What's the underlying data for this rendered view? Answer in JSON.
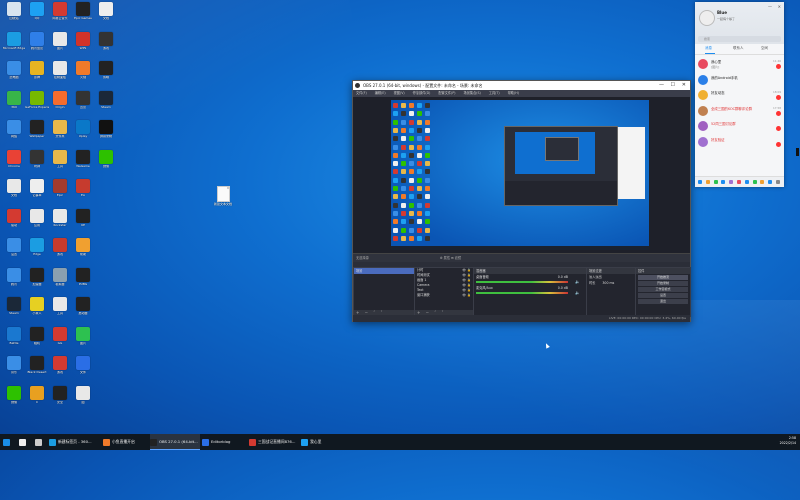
{
  "desktop": {
    "icons": [
      {
        "label": "回收站",
        "color": "#d8e4ef",
        "col": 0,
        "row": 0
      },
      {
        "label": "QQ",
        "color": "#1da1f2",
        "col": 1,
        "row": 0
      },
      {
        "label": "网易云音乐",
        "color": "#d33a31",
        "col": 2,
        "row": 0
      },
      {
        "label": "Epic Games",
        "color": "#222222",
        "col": 3,
        "row": 0
      },
      {
        "label": "文档",
        "color": "#eeeeee",
        "col": 4,
        "row": 0
      },
      {
        "label": "Microsoft Edge",
        "color": "#1b9de2",
        "col": 0,
        "row": 1
      },
      {
        "label": "腾讯会议",
        "color": "#2f7fe8",
        "col": 1,
        "row": 1
      },
      {
        "label": "图片",
        "color": "#e8e8e8",
        "col": 2,
        "row": 1
      },
      {
        "label": "WPS",
        "color": "#d2332a",
        "col": 3,
        "row": 1
      },
      {
        "label": "游戏",
        "color": "#333333",
        "col": 4,
        "row": 1
      },
      {
        "label": "此电脑",
        "color": "#3a8ee6",
        "col": 0,
        "row": 2
      },
      {
        "label": "原神",
        "color": "#e6b422",
        "col": 1,
        "row": 2
      },
      {
        "label": "控制面板",
        "color": "#e8e8e8",
        "col": 2,
        "row": 2
      },
      {
        "label": "火绒",
        "color": "#f07a2a",
        "col": 3,
        "row": 2
      },
      {
        "label": "剪映",
        "color": "#222222",
        "col": 4,
        "row": 2
      },
      {
        "label": "360",
        "color": "#38b549",
        "col": 0,
        "row": 3
      },
      {
        "label": "GeForce Experience",
        "color": "#76b900",
        "col": 1,
        "row": 3
      },
      {
        "label": "Origin",
        "color": "#f56c2d",
        "col": 2,
        "row": 3
      },
      {
        "label": "迅雷",
        "color": "#333333",
        "col": 3,
        "row": 3
      },
      {
        "label": "Steam",
        "color": "#1b2838",
        "col": 4,
        "row": 3
      },
      {
        "label": "网络",
        "color": "#3a8ee6",
        "col": 0,
        "row": 4
      },
      {
        "label": "Wallpaper",
        "color": "#222222",
        "col": 1,
        "row": 4
      },
      {
        "label": "文件夹",
        "color": "#e8b84a",
        "col": 2,
        "row": 4
      },
      {
        "label": "Uplay",
        "color": "#0a78c8",
        "col": 3,
        "row": 4
      },
      {
        "label": "屏幕录制",
        "color": "#111111",
        "col": 4,
        "row": 4
      },
      {
        "label": "Chrome",
        "color": "#e94235",
        "col": 0,
        "row": 5
      },
      {
        "label": "时钟",
        "color": "#333333",
        "col": 1,
        "row": 5
      },
      {
        "label": "工具",
        "color": "#e8b84a",
        "col": 2,
        "row": 5
      },
      {
        "label": "WeGame",
        "color": "#222222",
        "col": 3,
        "row": 5
      },
      {
        "label": "微信",
        "color": "#2dc100",
        "col": 4,
        "row": 5
      },
      {
        "label": "文档",
        "color": "#e8e8e8",
        "col": 0,
        "row": 6
      },
      {
        "label": "记事本",
        "color": "#eeeeee",
        "col": 1,
        "row": 6
      },
      {
        "label": "Epic",
        "color": "#a33b2e",
        "col": 2,
        "row": 6
      },
      {
        "label": "EA",
        "color": "#c63b2e",
        "col": 3,
        "row": 6
      },
      {
        "label": "驱动",
        "color": "#d33a31",
        "col": 0,
        "row": 7
      },
      {
        "label": "应用",
        "color": "#e8e8e8",
        "col": 1,
        "row": 7
      },
      {
        "label": "Rockstar",
        "color": "#e8e8e8",
        "col": 2,
        "row": 7
      },
      {
        "label": "UE",
        "color": "#222222",
        "col": 3,
        "row": 7
      },
      {
        "label": "设置",
        "color": "#3a8ee6",
        "col": 0,
        "row": 8
      },
      {
        "label": "Edge",
        "color": "#1b9de2",
        "col": 1,
        "row": 8
      },
      {
        "label": "游戏",
        "color": "#c63b2e",
        "col": 2,
        "row": 8
      },
      {
        "label": "帮助",
        "color": "#f0a030",
        "col": 3,
        "row": 8
      },
      {
        "label": "腾讯",
        "color": "#3a8ee6",
        "col": 0,
        "row": 9
      },
      {
        "label": "加速器",
        "color": "#222222",
        "col": 1,
        "row": 9
      },
      {
        "label": "模拟器",
        "color": "#8aa0b0",
        "col": 2,
        "row": 9
      },
      {
        "label": "PUBG",
        "color": "#222222",
        "col": 3,
        "row": 9
      },
      {
        "label": "Steam",
        "color": "#1b2838",
        "col": 0,
        "row": 10
      },
      {
        "label": "小黄人",
        "color": "#e6d022",
        "col": 1,
        "row": 10
      },
      {
        "label": "工具",
        "color": "#e8e8e8",
        "col": 2,
        "row": 10
      },
      {
        "label": "启动器",
        "color": "#222222",
        "col": 3,
        "row": 10
      },
      {
        "label": "Battle",
        "color": "#1a78d0",
        "col": 0,
        "row": 11
      },
      {
        "label": "相机",
        "color": "#222222",
        "col": 1,
        "row": 11
      },
      {
        "label": "GG",
        "color": "#d33a31",
        "col": 2,
        "row": 11
      },
      {
        "label": "图片",
        "color": "#2dc150",
        "col": 3,
        "row": 11
      },
      {
        "label": "音乐",
        "color": "#3a8ee6",
        "col": 0,
        "row": 12
      },
      {
        "label": "Black Desert",
        "color": "#222222",
        "col": 1,
        "row": 12
      },
      {
        "label": "游戏",
        "color": "#d33a31",
        "col": 2,
        "row": 12
      },
      {
        "label": "文件",
        "color": "#2a6ee6",
        "col": 3,
        "row": 12
      },
      {
        "label": "微信",
        "color": "#2dc100",
        "col": 0,
        "row": 13
      },
      {
        "label": "C",
        "color": "#e8a020",
        "col": 1,
        "row": 13
      },
      {
        "label": "安全",
        "color": "#222222",
        "col": 2,
        "row": 13
      },
      {
        "label": "图",
        "color": "#e8e8e8",
        "col": 3,
        "row": 13
      }
    ],
    "file_icon_label": "新建文本文档"
  },
  "obs": {
    "title": "OBS 27.0.1 (64-bit, windows) - 配置文件: 未命名 - 场景: 未命名",
    "menu": [
      "文件(F)",
      "编辑(E)",
      "视图(V)",
      "停靠部件(D)",
      "配置文件(P)",
      "场景集合(S)",
      "工具(T)",
      "帮助(H)"
    ],
    "toolbar_label": "无选择源",
    "toolbar_props": "⚙ 属性  ⊞ 滤镜",
    "scenes": {
      "header": "场景",
      "items": [
        "场景"
      ]
    },
    "sources": {
      "header": "来源",
      "items": [
        "计时",
        "时间测试",
        "画面 1",
        "Camera",
        "Text",
        "窗口捕获"
      ]
    },
    "mixer": {
      "header": "混音器",
      "channels": [
        {
          "name": "桌面音频",
          "db": "0.0 dB"
        },
        {
          "name": "麦克风/Aux",
          "db": "0.0 dB"
        }
      ]
    },
    "transitions": {
      "header": "场景过渡",
      "type": "淡入淡出",
      "duration_label": "时长",
      "duration": "300 ms"
    },
    "controls": {
      "header": "控件",
      "buttons": [
        "开始推流",
        "开始录制",
        "工作室模式",
        "设置",
        "退出"
      ]
    },
    "dock_footer": "+ − ˄ ˅",
    "status": "LIVE: 00:00:00   REC: 00:00:00   CPU: 3.4%, 60.00 fps"
  },
  "qq": {
    "name": "Blue",
    "status": "一起嗨个够了",
    "search_placeholder": "搜索",
    "tabs": [
      "消息",
      "联系人",
      "空间"
    ],
    "chats": [
      {
        "name": "我心里",
        "msg": "[图片]",
        "time": "11:46",
        "color": "#e84a5f",
        "badge": true
      },
      {
        "name": "我的Android手机",
        "msg": "",
        "time": "",
        "color": "#2a7fe8",
        "badge": false
      },
      {
        "name": "好友动态",
        "msg": "",
        "time": "18:09",
        "color": "#f0b030",
        "badge": true
      },
      {
        "name": "全成三国的KOC群聊评论群",
        "msg": "",
        "time": "17:58",
        "color": "#c08050",
        "badge": true
      },
      {
        "name": "52同三国讨论群",
        "msg": "",
        "time": "",
        "color": "#a060c0",
        "badge": true
      },
      {
        "name": "好友验证",
        "msg": "",
        "time": "",
        "color": "#a070d0",
        "badge": true
      }
    ]
  },
  "taskbar": {
    "items": [
      {
        "label": "",
        "color": "#1a8de6"
      },
      {
        "label": "",
        "color": "#eeeeee"
      },
      {
        "label": "",
        "color": "#cccccc"
      },
      {
        "label": "新建标签页 - 360...",
        "color": "#1b9de2"
      },
      {
        "label": "小鱼直播开启",
        "color": "#f07a2a"
      },
      {
        "label": "OBS 27.0.1 (64-bit...",
        "color": "#222222"
      },
      {
        "label": "Editorblog",
        "color": "#2a6ee6"
      },
      {
        "label": "三国战记直播间876...",
        "color": "#d33a31"
      },
      {
        "label": "我心里",
        "color": "#1da1f2"
      }
    ],
    "tray_time": "2:58",
    "tray_date": "2022/2/14"
  }
}
